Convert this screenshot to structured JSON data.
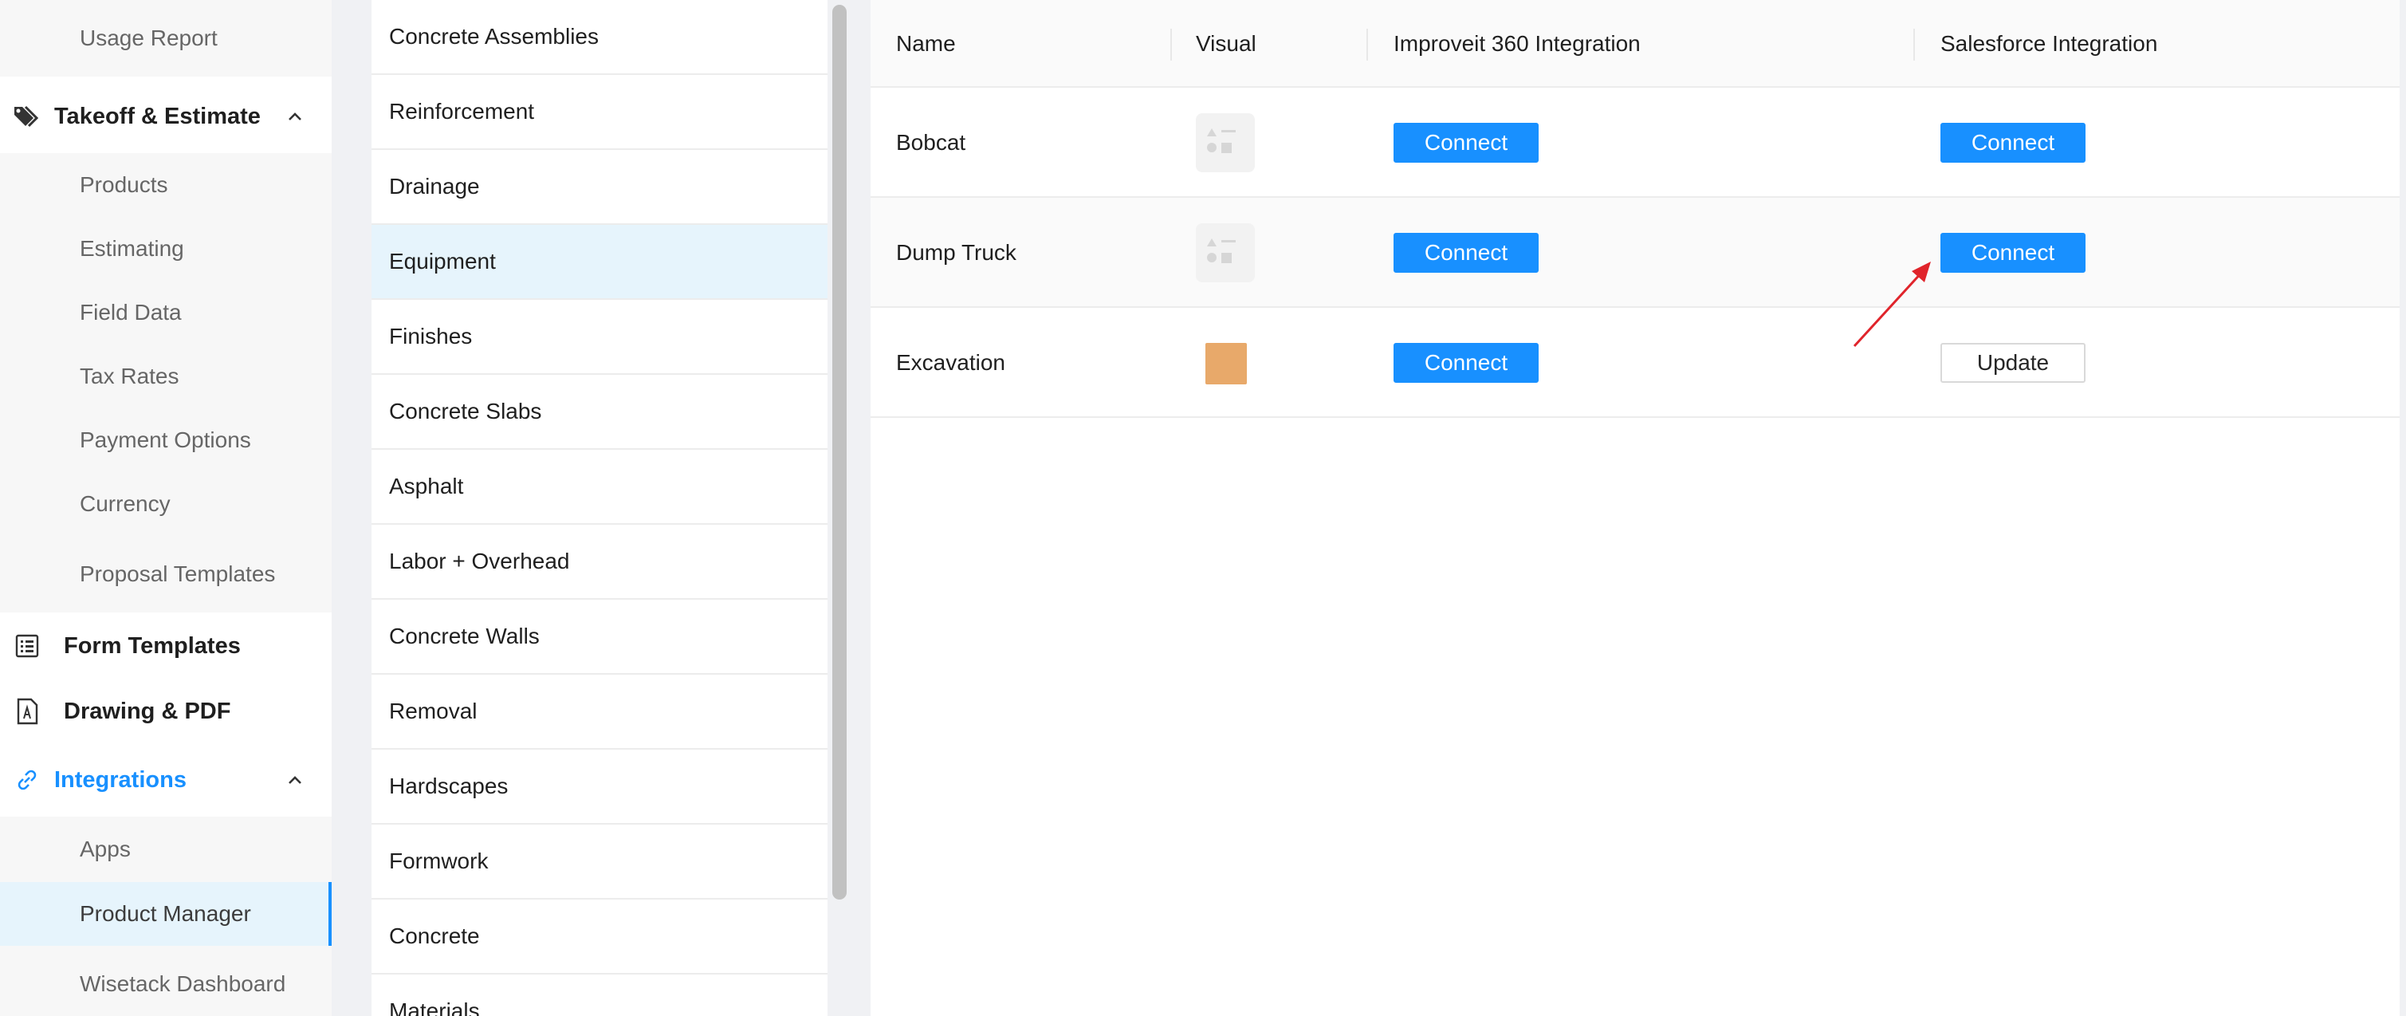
{
  "sidebar": {
    "usage_report": "Usage Report",
    "takeoff_estimate": {
      "label": "Takeoff & Estimate",
      "icon": "tags-icon",
      "items": [
        "Products",
        "Estimating",
        "Field Data",
        "Tax Rates",
        "Payment Options",
        "Currency",
        "Proposal Templates"
      ]
    },
    "form_templates": {
      "label": "Form Templates",
      "icon": "list-form-icon"
    },
    "drawing_pdf": {
      "label": "Drawing & PDF",
      "icon": "pdf-document-icon"
    },
    "integrations": {
      "label": "Integrations",
      "icon": "link-icon",
      "items": [
        "Apps",
        "Product Manager",
        "Wisetack Dashboard"
      ],
      "active_item": "Product Manager"
    }
  },
  "categories": {
    "items": [
      "Concrete Assemblies",
      "Reinforcement",
      "Drainage",
      "Equipment",
      "Finishes",
      "Concrete Slabs",
      "Asphalt",
      "Labor + Overhead",
      "Concrete Walls",
      "Removal",
      "Hardscapes",
      "Formwork",
      "Concrete",
      "Materials"
    ],
    "selected": "Equipment"
  },
  "table": {
    "headers": {
      "name": "Name",
      "visual": "Visual",
      "improveit": "Improveit 360 Integration",
      "salesforce": "Salesforce Integration"
    },
    "rows": [
      {
        "name": "Bobcat",
        "visual": "placeholder-image-icon",
        "improveit": "Connect",
        "salesforce": "Connect"
      },
      {
        "name": "Dump Truck",
        "visual": "placeholder-image-icon",
        "improveit": "Connect",
        "salesforce": "Connect"
      },
      {
        "name": "Excavation",
        "visual_color": "#E8A96A",
        "improveit": "Connect",
        "salesforce": "Update"
      }
    ]
  },
  "colors": {
    "accent": "#1890FF",
    "annotation_arrow": "#E0242B"
  }
}
